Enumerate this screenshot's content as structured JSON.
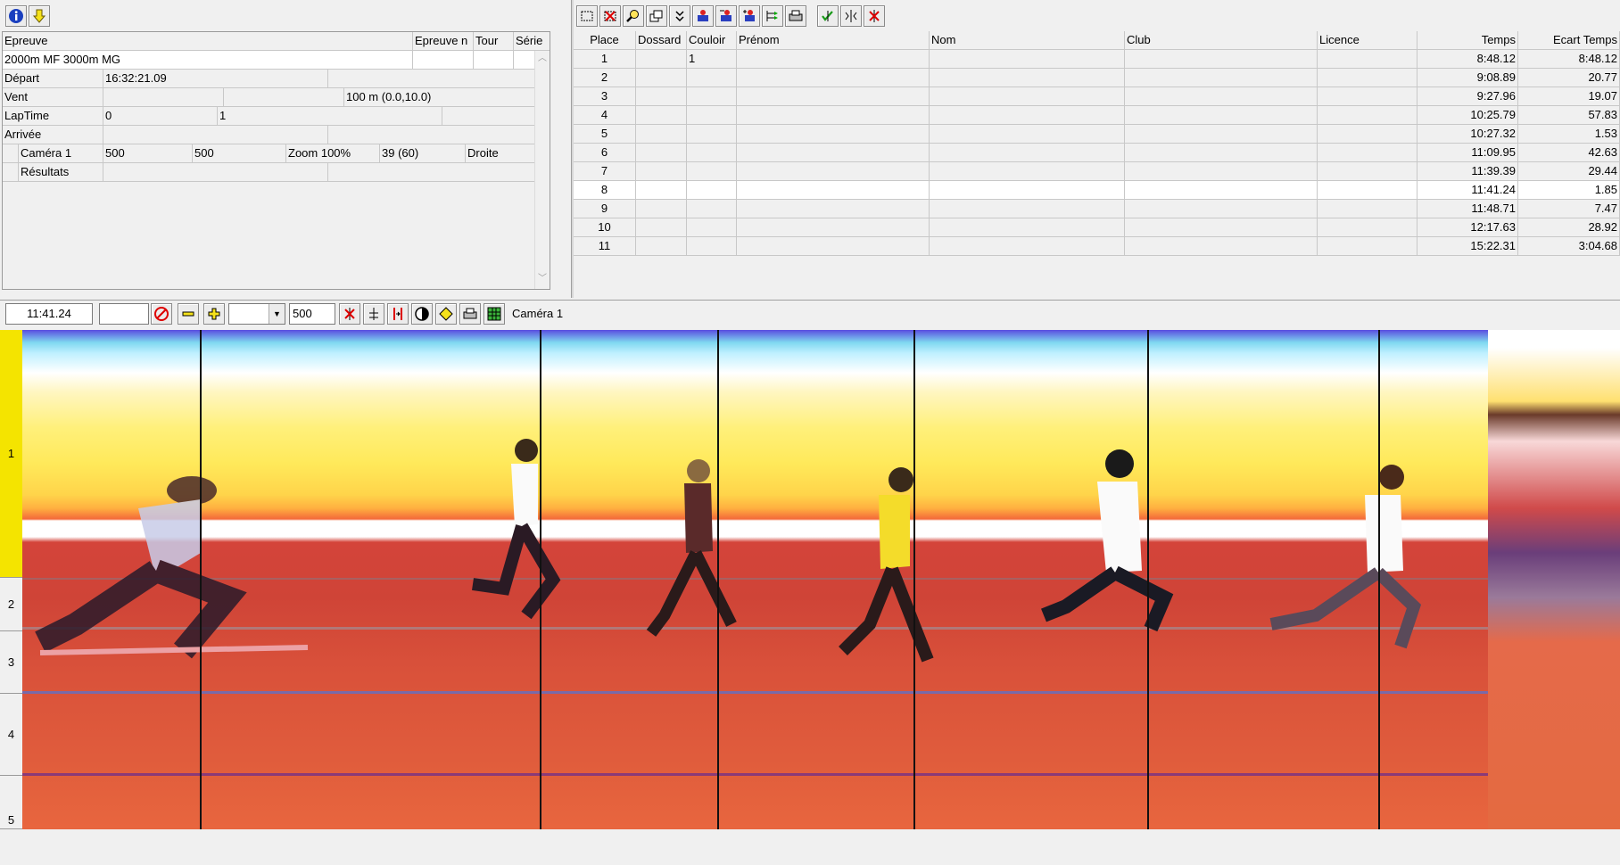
{
  "left_panel": {
    "headers": {
      "epreuve": "Epreuve",
      "epreuve_n": "Epreuve n",
      "tour": "Tour",
      "serie": "Série"
    },
    "event_name": "2000m MF 3000m MG",
    "depart": {
      "label": "Départ",
      "value": "16:32:21.09"
    },
    "vent": {
      "label": "Vent",
      "value": "100 m (0.0,10.0)"
    },
    "laptime": {
      "label": "LapTime",
      "v1": "0",
      "v2": "1"
    },
    "arrivee": {
      "label": "Arrivée"
    },
    "camera": {
      "label": "Caméra 1",
      "v1": "500",
      "v2": "500",
      "zoom": "Zoom 100%",
      "frames": "39  (60)",
      "side": "Droite"
    },
    "resultats": {
      "label": "Résultats"
    }
  },
  "results": {
    "headers": [
      "Place",
      "Dossard",
      "Couloir",
      "Prénom",
      "Nom",
      "Club",
      "Licence",
      "Temps",
      "Ecart Temps"
    ],
    "rows": [
      {
        "place": "1",
        "couloir": "1",
        "temps": "8:48.12",
        "ecart": "8:48.12"
      },
      {
        "place": "2",
        "couloir": "",
        "temps": "9:08.89",
        "ecart": "20.77"
      },
      {
        "place": "3",
        "couloir": "",
        "temps": "9:27.96",
        "ecart": "19.07"
      },
      {
        "place": "4",
        "couloir": "",
        "temps": "10:25.79",
        "ecart": "57.83"
      },
      {
        "place": "5",
        "couloir": "",
        "temps": "10:27.32",
        "ecart": "1.53"
      },
      {
        "place": "6",
        "couloir": "",
        "temps": "11:09.95",
        "ecart": "42.63"
      },
      {
        "place": "7",
        "couloir": "",
        "temps": "11:39.39",
        "ecart": "29.44"
      },
      {
        "place": "8",
        "couloir": "",
        "temps": "11:41.24",
        "ecart": "1.85"
      },
      {
        "place": "9",
        "couloir": "",
        "temps": "11:48.71",
        "ecart": "7.47"
      },
      {
        "place": "10",
        "couloir": "",
        "temps": "12:17.63",
        "ecart": "28.92"
      },
      {
        "place": "11",
        "couloir": "",
        "temps": "15:22.31",
        "ecart": "3:04.68"
      }
    ],
    "selected_place": "8"
  },
  "bottom_bar": {
    "time": "11:41.24",
    "width_value": "500",
    "camera_label": "Caméra 1"
  },
  "lanes": [
    "1",
    "2",
    "3",
    "4",
    "5"
  ],
  "colors": {
    "lane1_marker": "#f4e400",
    "accent": "#1a3fbf"
  }
}
